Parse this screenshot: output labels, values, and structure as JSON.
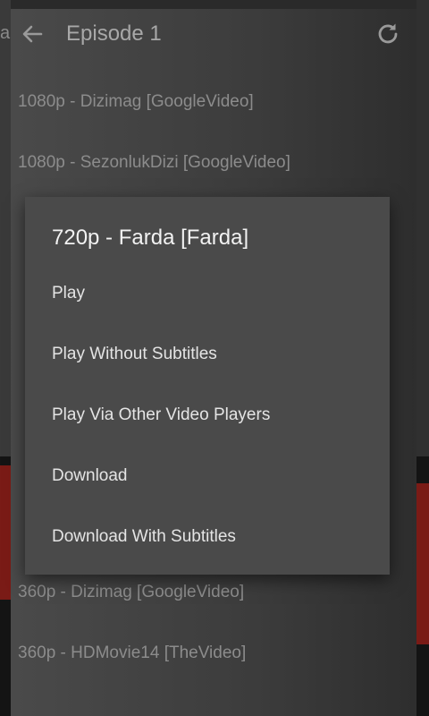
{
  "background_app": {
    "left_text": "ar"
  },
  "toolbar": {
    "back_icon": "arrow-left-icon",
    "title": "Episode 1",
    "refresh_icon": "refresh-icon"
  },
  "sources": [
    {
      "label": "1080p - Dizimag [GoogleVideo]"
    },
    {
      "label": "1080p - SezonlukDizi [GoogleVideo]"
    },
    {
      "label": "360p - Dizimag [GoogleVideo]"
    },
    {
      "label": "360p - HDMovie14 [TheVideo]"
    }
  ],
  "dialog": {
    "title": "720p - Farda [Farda]",
    "options": [
      {
        "label": "Play"
      },
      {
        "label": "Play Without Subtitles"
      },
      {
        "label": "Play Via Other Video Players"
      },
      {
        "label": "Download"
      },
      {
        "label": "Download With Subtitles"
      }
    ]
  },
  "colors": {
    "dialog_bg": "#4a4a4a",
    "dialog_text": "#e4e4e4",
    "dimmed_text": "#8c8c8c"
  }
}
